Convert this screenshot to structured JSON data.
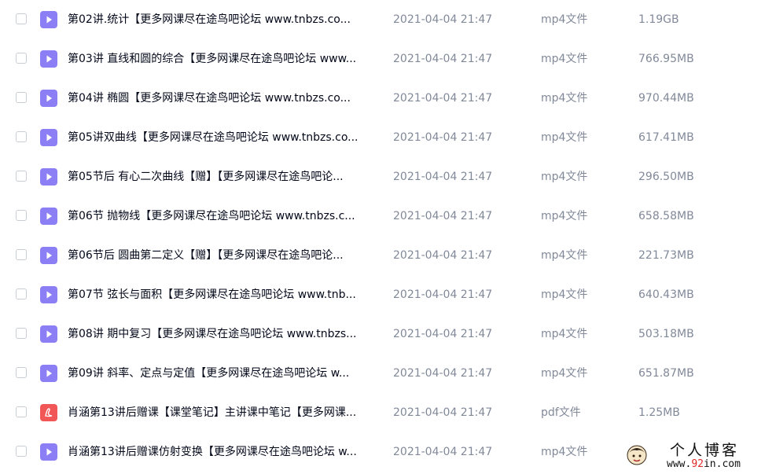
{
  "files": [
    {
      "name": "第02讲.统计【更多网课尽在途鸟吧论坛 www.tnbzs.co...",
      "date": "2021-04-04 21:47",
      "type": "mp4文件",
      "size": "1.19GB",
      "icon": "video-file-icon",
      "icon_color": "#8c7ff5"
    },
    {
      "name": "第03讲 直线和圆的综合【更多网课尽在途鸟吧论坛 www...",
      "date": "2021-04-04 21:47",
      "type": "mp4文件",
      "size": "766.95MB",
      "icon": "video-file-icon",
      "icon_color": "#8c7ff5"
    },
    {
      "name": "第04讲 椭圆【更多网课尽在途鸟吧论坛 www.tnbzs.co...",
      "date": "2021-04-04 21:47",
      "type": "mp4文件",
      "size": "970.44MB",
      "icon": "video-file-icon",
      "icon_color": "#8c7ff5"
    },
    {
      "name": "第05讲双曲线【更多网课尽在途鸟吧论坛 www.tnbzs.co...",
      "date": "2021-04-04 21:47",
      "type": "mp4文件",
      "size": "617.41MB",
      "icon": "video-file-icon",
      "icon_color": "#8c7ff5"
    },
    {
      "name": "第05节后 有心二次曲线【赠】【更多网课尽在途鸟吧论...",
      "date": "2021-04-04 21:47",
      "type": "mp4文件",
      "size": "296.50MB",
      "icon": "video-file-icon",
      "icon_color": "#8c7ff5"
    },
    {
      "name": "第06节 抛物线【更多网课尽在途鸟吧论坛 www.tnbzs.c...",
      "date": "2021-04-04 21:47",
      "type": "mp4文件",
      "size": "658.58MB",
      "icon": "video-file-icon",
      "icon_color": "#8c7ff5"
    },
    {
      "name": "第06节后 圆曲第二定义【赠】【更多网课尽在途鸟吧论...",
      "date": "2021-04-04 21:47",
      "type": "mp4文件",
      "size": "221.73MB",
      "icon": "video-file-icon",
      "icon_color": "#8c7ff5"
    },
    {
      "name": "第07节 弦长与面积【更多网课尽在途鸟吧论坛 www.tnb...",
      "date": "2021-04-04 21:47",
      "type": "mp4文件",
      "size": "640.43MB",
      "icon": "video-file-icon",
      "icon_color": "#8c7ff5"
    },
    {
      "name": "第08讲 期中复习【更多网课尽在途鸟吧论坛 www.tnbzs...",
      "date": "2021-04-04 21:47",
      "type": "mp4文件",
      "size": "503.18MB",
      "icon": "video-file-icon",
      "icon_color": "#8c7ff5"
    },
    {
      "name": "第09讲 斜率、定点与定值【更多网课尽在途鸟吧论坛 w...",
      "date": "2021-04-04 21:47",
      "type": "mp4文件",
      "size": "651.87MB",
      "icon": "video-file-icon",
      "icon_color": "#8c7ff5"
    },
    {
      "name": "肖涵第13讲后赠课【课堂笔记】主讲课中笔记【更多网课...",
      "date": "2021-04-04 21:47",
      "type": "pdf文件",
      "size": "1.25MB",
      "icon": "pdf-file-icon",
      "icon_color": "#f25757"
    },
    {
      "name": "肖涵第13讲后赠课仿射变换【更多网课尽在途鸟吧论坛 w...",
      "date": "2021-04-04 21:47",
      "type": "mp4文件",
      "size": "",
      "icon": "video-file-icon",
      "icon_color": "#8c7ff5"
    }
  ],
  "watermark": {
    "title": "个人博客",
    "url_prefix": "www.",
    "url_highlight": "92",
    "url_suffix": "in.com"
  }
}
